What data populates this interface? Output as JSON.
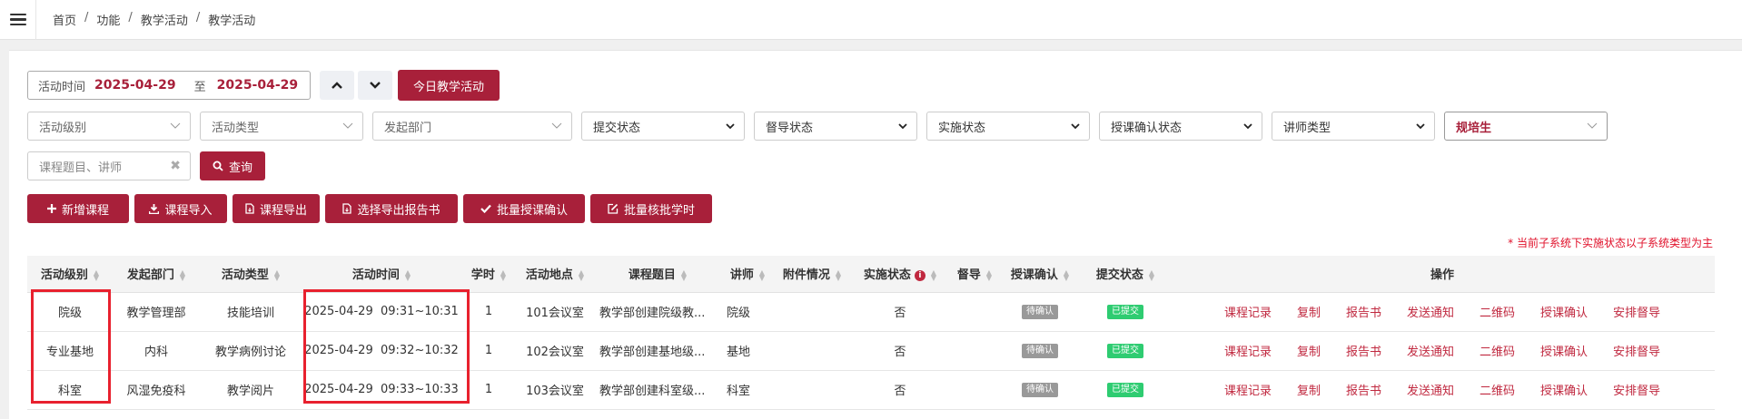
{
  "breadcrumb": [
    "首页",
    "功能",
    "教学活动",
    "教学活动"
  ],
  "date_range": {
    "label": "活动时间",
    "start": "2025-04-29",
    "to": "至",
    "end": "2025-04-29"
  },
  "today_button": "今日教学活动",
  "filters": [
    {
      "label": "活动级别",
      "caret": "chevron-down"
    },
    {
      "label": "活动类型",
      "caret": "chevron-down"
    },
    {
      "label": "发起部门",
      "caret": "chevron-down"
    },
    {
      "label": "提交状态",
      "caret": "select-arrow"
    },
    {
      "label": "督导状态",
      "caret": "select-arrow"
    },
    {
      "label": "实施状态",
      "caret": "select-arrow"
    },
    {
      "label": "授课确认状态",
      "caret": "select-arrow"
    },
    {
      "label": "讲师类型",
      "caret": "select-arrow"
    },
    {
      "label": "规培生",
      "caret": "chevron-down"
    }
  ],
  "search": {
    "placeholder": "课程题目、讲师",
    "button": "查询"
  },
  "actions": [
    "新增课程",
    "课程导入",
    "课程导出",
    "选择导出报告书",
    "批量授课确认",
    "批量核批学时"
  ],
  "note": "* 当前子系统下实施状态以子系统类型为主",
  "columns": [
    "活动级别",
    "发起部门",
    "活动类型",
    "活动时间",
    "学时",
    "活动地点",
    "课程题目",
    "讲师",
    "附件情况",
    "实施状态",
    "督导",
    "授课确认",
    "提交状态",
    "操作"
  ],
  "rows": [
    {
      "level": "院级",
      "dept": "教学管理部",
      "type": "技能培训",
      "time": "2025-04-29  09:31~10:31",
      "hours": "1",
      "place": "101会议室",
      "title": "教学部创建院级教...",
      "teacher": "院级",
      "attach": "",
      "impl": "否",
      "supervise": "",
      "confirm": "待确认",
      "submit": "已提交"
    },
    {
      "level": "专业基地",
      "dept": "内科",
      "type": "教学病例讨论",
      "time": "2025-04-29  09:32~10:32",
      "hours": "1",
      "place": "102会议室",
      "title": "教学部创建基地级...",
      "teacher": "基地",
      "attach": "",
      "impl": "否",
      "supervise": "",
      "confirm": "待确认",
      "submit": "已提交"
    },
    {
      "level": "科室",
      "dept": "风湿免疫科",
      "type": "教学阅片",
      "time": "2025-04-29  09:33~10:33",
      "hours": "1",
      "place": "103会议室",
      "title": "教学部创建科室级...",
      "teacher": "科室",
      "attach": "",
      "impl": "否",
      "supervise": "",
      "confirm": "待确认",
      "submit": "已提交"
    }
  ],
  "operations": [
    "课程记录",
    "复制",
    "报告书",
    "发送通知",
    "二维码",
    "授课确认",
    "安排督导"
  ],
  "colors": {
    "brand": "#a8203a",
    "success": "#2ecc71",
    "pending": "#999999",
    "highlight": "#e8212e"
  }
}
